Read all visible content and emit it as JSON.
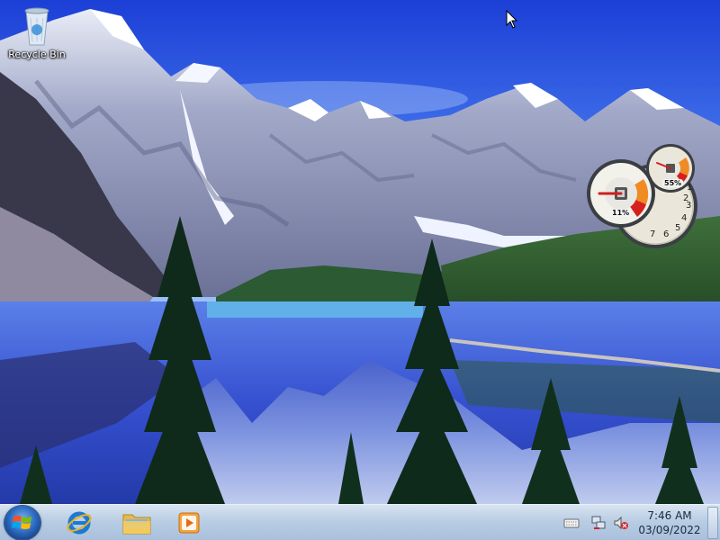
{
  "desktop": {
    "icons": [
      {
        "label": "Recycle Bin",
        "icon": "recycle-bin-icon"
      }
    ]
  },
  "gadget": {
    "name": "cpu-meter-gadget",
    "cpu_usage": "11%",
    "memory_usage": "55%",
    "cpu_fraction": 0.11,
    "memory_fraction": 0.55,
    "dial_numbers": [
      "1",
      "2",
      "3",
      "4",
      "5",
      "6",
      "7"
    ]
  },
  "taskbar": {
    "start_icon": "windows-logo-icon",
    "pinned": [
      {
        "icon": "internet-explorer-icon"
      },
      {
        "icon": "folder-icon"
      },
      {
        "icon": "media-player-icon"
      }
    ],
    "tray_icons": [
      "keyboard-icon",
      "network-icon",
      "volume-muted-icon"
    ],
    "clock": {
      "time": "7:46 AM",
      "date": "03/09/2022"
    }
  },
  "colors": {
    "taskbar_top": "#d8e4f1",
    "taskbar_bottom": "#a9c0dc",
    "sky": "#2c5fe0",
    "lake": "#3b58d8"
  }
}
